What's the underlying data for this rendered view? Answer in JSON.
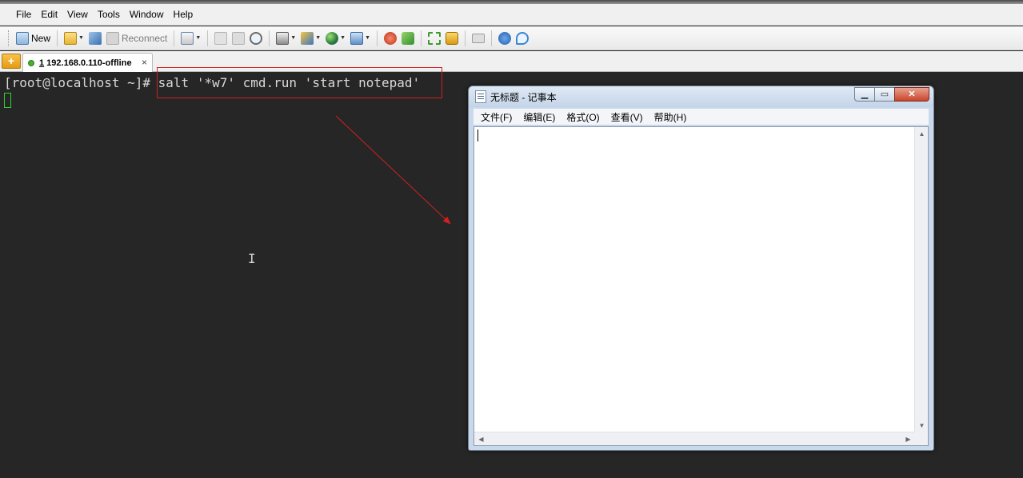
{
  "menubar": {
    "items": [
      "File",
      "Edit",
      "View",
      "Tools",
      "Window",
      "Help"
    ]
  },
  "toolbar": {
    "new_label": "New",
    "reconnect_label": "Reconnect"
  },
  "tabs": {
    "active": {
      "number": "1",
      "label": " 192.168.0.110-offline",
      "close": "×"
    }
  },
  "terminal": {
    "prompt": "[root@localhost ~]# ",
    "command": "salt '*w7' cmd.run 'start notepad'",
    "mouse_cursor": "I"
  },
  "notepad": {
    "title": "无标题 - 记事本",
    "menu": [
      "文件(F)",
      "编辑(E)",
      "格式(O)",
      "查看(V)",
      "帮助(H)"
    ],
    "buttons": {
      "minimize": "▁",
      "maximize": "▭",
      "close": "✕"
    }
  },
  "colors": {
    "terminal_bg": "#262626",
    "cursor_green": "#2fd22f",
    "annotation_red": "#d02020"
  },
  "icons": [
    "new-session-icon",
    "open-folder-icon",
    "connect-icon",
    "reconnect-icon",
    "properties-icon",
    "copy-icon",
    "paste-icon",
    "find-icon",
    "print-icon",
    "transfer-icon",
    "globe-icon",
    "script-icon",
    "xshell-icon",
    "xftp-icon",
    "fullscreen-icon",
    "lock-icon",
    "keyboard-icon",
    "help-icon",
    "chat-icon"
  ]
}
